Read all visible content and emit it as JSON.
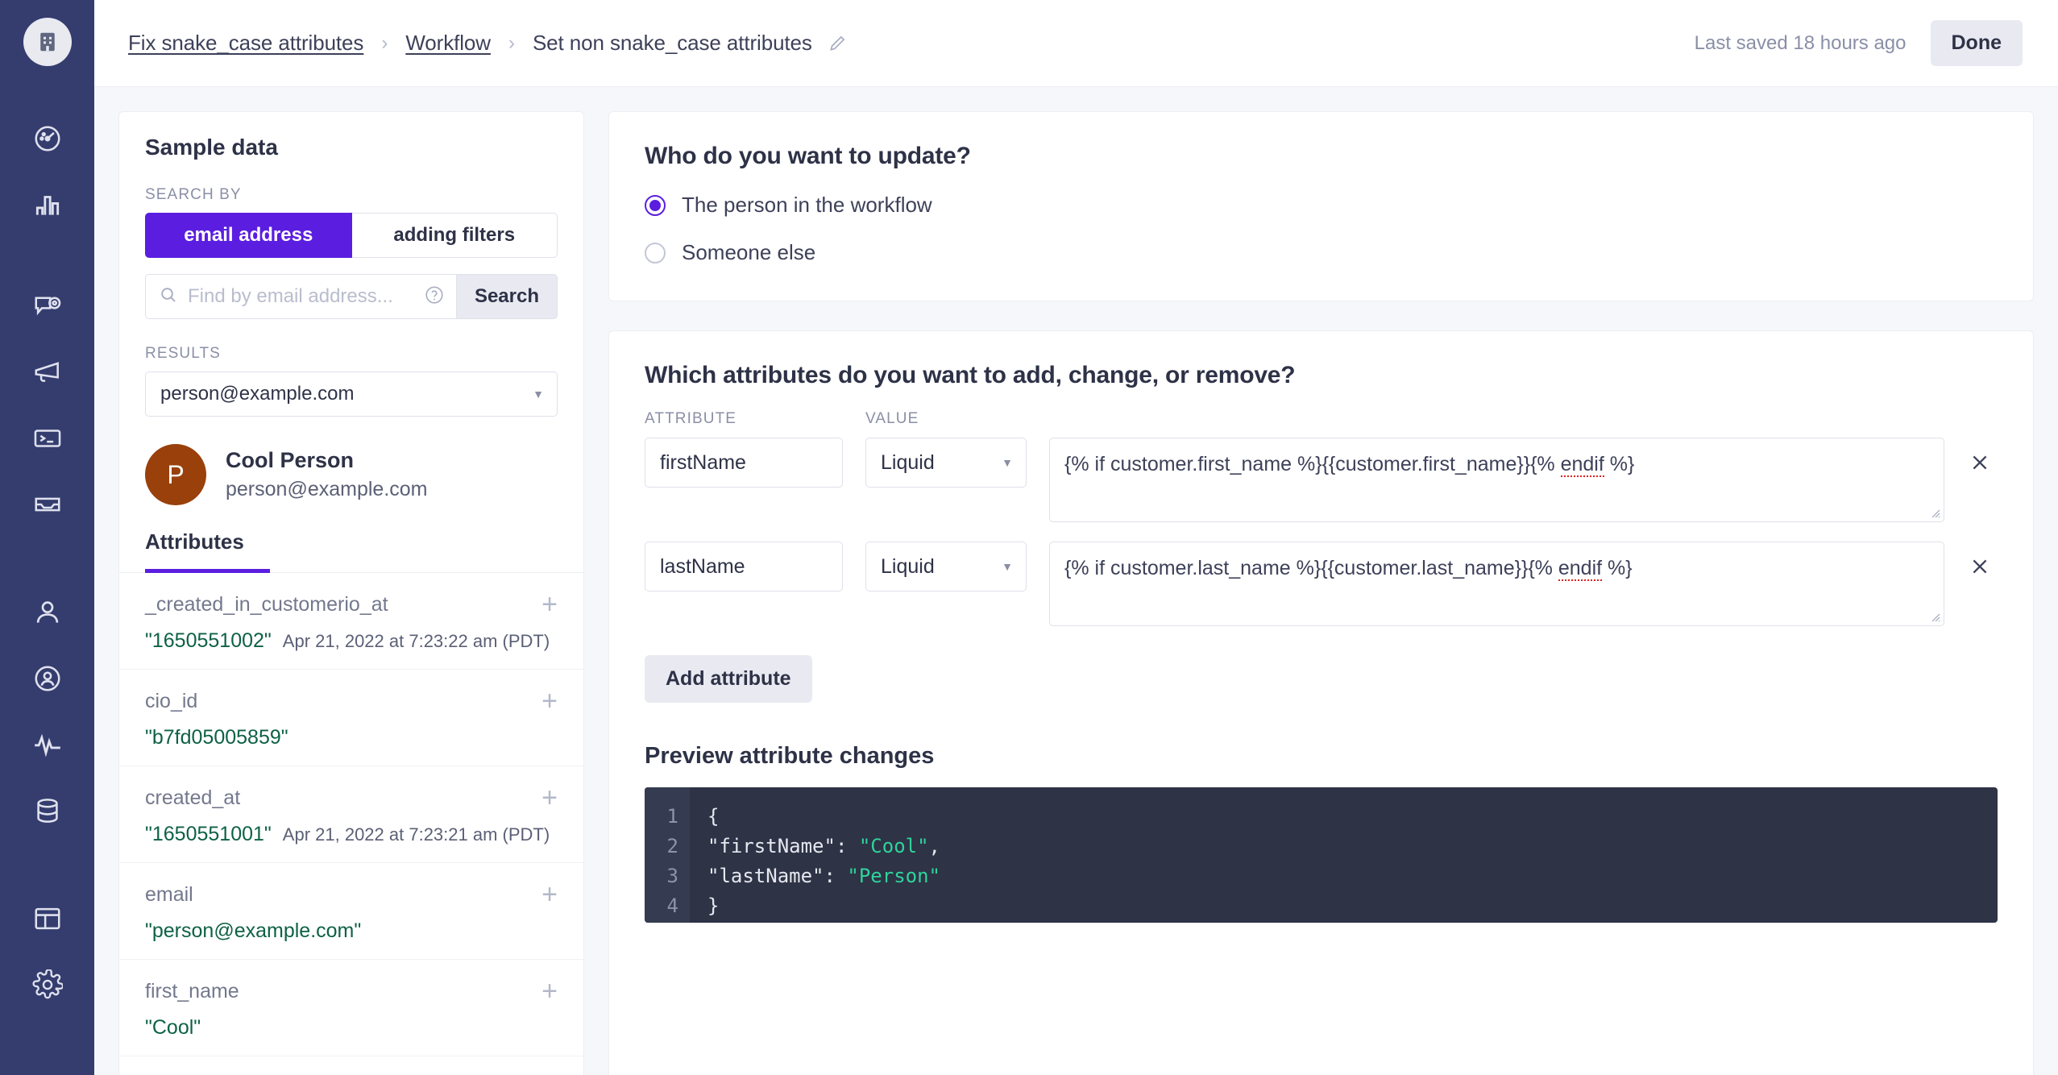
{
  "nav": {
    "logo_icon": "building-icon",
    "items": [
      {
        "icon": "gauge-icon",
        "name": "dashboard"
      },
      {
        "icon": "bar-chart-icon",
        "name": "metrics"
      },
      {
        "icon": "message-target-icon",
        "name": "campaigns"
      },
      {
        "icon": "megaphone-icon",
        "name": "broadcasts"
      },
      {
        "icon": "terminal-icon",
        "name": "transactional"
      },
      {
        "icon": "inbox-icon",
        "name": "newsletters"
      },
      {
        "icon": "person-icon",
        "name": "people"
      },
      {
        "icon": "person-circle-icon",
        "name": "segments"
      },
      {
        "icon": "activity-icon",
        "name": "activity"
      },
      {
        "icon": "database-icon",
        "name": "data"
      },
      {
        "icon": "layout-icon",
        "name": "content"
      },
      {
        "icon": "gear-icon",
        "name": "settings"
      }
    ]
  },
  "topbar": {
    "breadcrumb": [
      {
        "label": "Fix snake_case attributes",
        "link": true
      },
      {
        "label": "Workflow",
        "link": true
      },
      {
        "label": "Set non snake_case attributes",
        "link": false
      }
    ],
    "separator": "›",
    "edit_icon": "pencil-icon",
    "saved_text": "Last saved 18 hours ago",
    "done_label": "Done"
  },
  "sample": {
    "title": "Sample data",
    "search_by_label": "SEARCH BY",
    "segments": [
      {
        "label": "email address",
        "selected": true
      },
      {
        "label": "adding filters",
        "selected": false
      }
    ],
    "search_placeholder": "Find by email address...",
    "search_value": "",
    "search_icon": "search-icon",
    "help_icon": "question-circle-icon",
    "search_button": "Search",
    "results_label": "RESULTS",
    "results_selected": "person@example.com",
    "person": {
      "initial": "P",
      "name": "Cool Person",
      "email": "person@example.com",
      "avatar_color": "#99400b"
    },
    "tab_label": "Attributes",
    "attributes": [
      {
        "key": "_created_in_customerio_at",
        "value": "\"1650551002\"",
        "timestamp": "Apr 21, 2022 at 7:23:22 am (PDT)"
      },
      {
        "key": "cio_id",
        "value": "\"b7fd05005859\"",
        "timestamp": ""
      },
      {
        "key": "created_at",
        "value": "\"1650551001\"",
        "timestamp": "Apr 21, 2022 at 7:23:21 am (PDT)"
      },
      {
        "key": "email",
        "value": "\"person@example.com\"",
        "timestamp": ""
      },
      {
        "key": "first_name",
        "value": "\"Cool\"",
        "timestamp": ""
      }
    ],
    "add_icon": "plus-icon"
  },
  "who": {
    "heading": "Who do you want to update?",
    "options": [
      {
        "label": "The person in the workflow",
        "selected": true
      },
      {
        "label": "Someone else",
        "selected": false
      }
    ]
  },
  "attributes_section": {
    "heading": "Which attributes do you want to add, change, or remove?",
    "col_attribute": "ATTRIBUTE",
    "col_value": "VALUE",
    "rows": [
      {
        "attribute": "firstName",
        "type": "Liquid",
        "value_before": "{% if customer.first_name %}{{customer.first_name}}{% ",
        "value_spell": "endif",
        "value_after": " %}",
        "remove_icon": "close-icon"
      },
      {
        "attribute": "lastName",
        "type": "Liquid",
        "value_before": "{% if customer.last_name %}{{customer.last_name}}{% ",
        "value_spell": "endif",
        "value_after": " %}",
        "remove_icon": "close-icon"
      }
    ],
    "add_attribute_label": "Add attribute",
    "preview_heading": "Preview attribute changes",
    "preview_lines": [
      "1",
      "2",
      "3",
      "4"
    ],
    "preview_code": {
      "line1": "{",
      "line2_key": "  \"firstName\": ",
      "line2_val": "\"Cool\"",
      "line2_tail": ",",
      "line3_key": "  \"lastName\": ",
      "line3_val": "\"Person\"",
      "line4": "}"
    }
  },
  "colors": {
    "nav_bg": "#343d6e",
    "accent": "#5b1ee0",
    "page_bg": "#f6f7fa",
    "code_bg": "#2e3346",
    "code_string": "#2fd39b",
    "attr_value": "#0e6146"
  }
}
